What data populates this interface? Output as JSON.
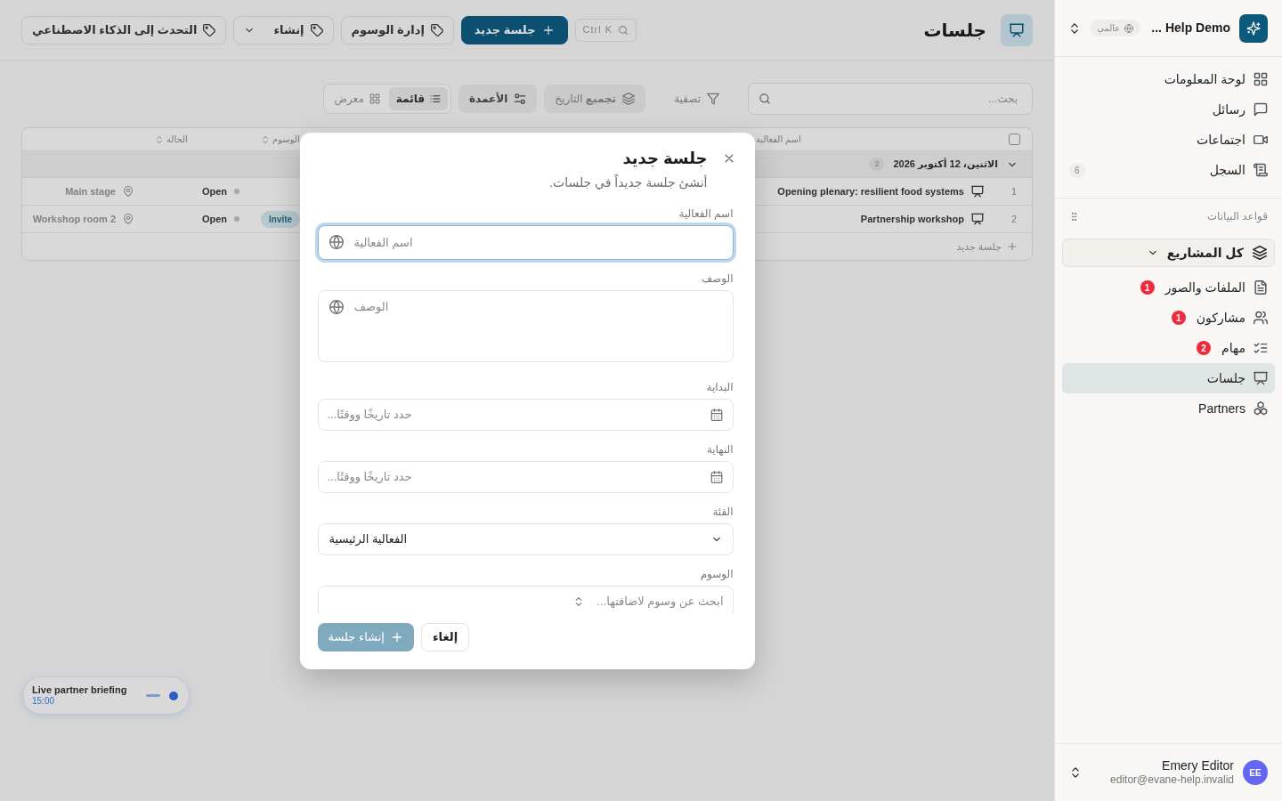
{
  "sidebar": {
    "workspace": {
      "name": "Help Demo ...",
      "badge": "عالمي"
    },
    "nav": [
      {
        "label": "لوحة المعلومات",
        "selected": false
      },
      {
        "label": "رسائل",
        "selected": false
      },
      {
        "label": "اجتماعات",
        "selected": false
      },
      {
        "label": "السجل",
        "count": "6",
        "selected": false
      }
    ],
    "section": "قواعد البيانات",
    "project_picker": "كل المشاريع",
    "databases": [
      {
        "label": "الملفات والصور",
        "badge": "1",
        "selected": false
      },
      {
        "label": "مشاركون",
        "badge": "1",
        "selected": false
      },
      {
        "label": "مهام",
        "badge": "2",
        "selected": false
      },
      {
        "label": "جلسات",
        "selected": true
      },
      {
        "label": "Partners",
        "selected": false
      }
    ],
    "user": {
      "initials": "EE",
      "name": "Emery Editor",
      "email": "editor@evane-help.invalid"
    }
  },
  "page_header": {
    "title": "جلسات",
    "search_shortcut": "Ctrl K",
    "actions": [
      {
        "kind": "primary",
        "label": "جلسة جديد"
      },
      {
        "kind": "tags",
        "label": "إدارة الوسوم"
      },
      {
        "kind": "dropdown",
        "label": "إنشاء"
      },
      {
        "kind": "ai",
        "label": "التحدث إلى الذكاء الاصطناعي"
      }
    ]
  },
  "toolbar": {
    "search": {
      "placeholder": "بحث..."
    },
    "filter": "تصفية",
    "group_by": "**تجميع** التاريخ",
    "columns": "الأعمدة",
    "views": [
      {
        "label": "قائمة",
        "selected": true
      },
      {
        "label": "معرض",
        "selected": false
      }
    ]
  },
  "table": {
    "select_all": {
      "checked": false
    },
    "columns": [
      {
        "label": "اسم الفعالية",
        "sortable": false
      },
      {
        "label": "الوسوم",
        "sortable": true
      },
      {
        "label": "الحالة",
        "sortable": true
      }
    ],
    "groups": [
      {
        "label": "الاثنين، 12 أكتوبر 2026",
        "count": "2",
        "expanded": true,
        "rows": [
          {
            "number": "1",
            "name": "Opening plenary: resilient food systems",
            "status": "Open",
            "location": "Main stage"
          },
          {
            "number": "2",
            "name": "Partnership workshop",
            "tags": [
              "Invite"
            ],
            "status": "Open",
            "location": "Workshop room 2"
          }
        ]
      }
    ],
    "add_row": "جلسة جديد"
  },
  "live_event": {
    "title": "Live partner briefing",
    "time": "15:00"
  },
  "dialog": {
    "title": "جلسة جديد",
    "subtitle": "أنشئ جلسة جديداً في جلسات.",
    "fields": [
      {
        "kind": "text",
        "label": "اسم الفعالية",
        "placeholder": "اسم الفعالية",
        "focused": true
      },
      {
        "kind": "textarea",
        "label": "الوصف",
        "placeholder": "الوصف",
        "focused": false
      },
      {
        "kind": "datetime",
        "label": "البداية",
        "placeholder": "حدد تاريخًا ووقتًا...",
        "focused": false
      },
      {
        "kind": "datetime",
        "label": "النهاية",
        "placeholder": "حدد تاريخًا ووقتًا...",
        "focused": false
      },
      {
        "kind": "select",
        "label": "الفئة",
        "value": "الفعالية الرئيسية",
        "focused": false
      },
      {
        "kind": "combobox",
        "label": "الوسوم",
        "placeholder": "ابحث عن وسوم لاضافتها...",
        "focused": false
      }
    ],
    "submit": {
      "label": "إنشاء جلسة",
      "disabled": true
    },
    "cancel": "إلغاء"
  }
}
